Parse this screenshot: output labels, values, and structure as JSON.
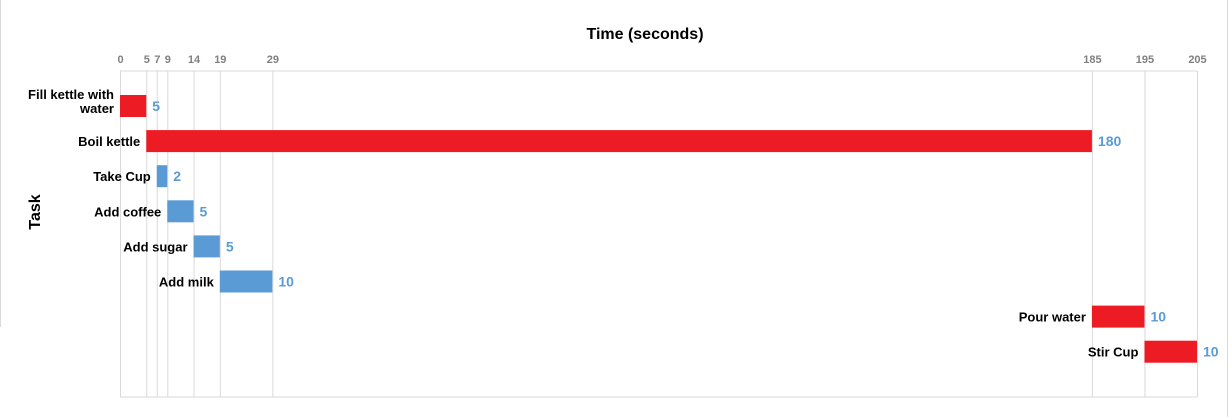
{
  "chart_data": {
    "type": "bar",
    "title": "Time (seconds)",
    "xlabel": "Time (seconds)",
    "ylabel": "Task",
    "xlim": [
      0,
      205
    ],
    "x_ticks": [
      "0",
      "5",
      "7",
      "9",
      "14",
      "19",
      "29",
      "185",
      "195",
      "205"
    ],
    "tasks": [
      {
        "label": [
          "Fill kettle with",
          "water"
        ],
        "start": 0,
        "duration": 5,
        "value_label": "5",
        "color": "#ed1c24"
      },
      {
        "label": [
          "Boil kettle"
        ],
        "start": 5,
        "duration": 180,
        "value_label": "180",
        "color": "#ed1c24"
      },
      {
        "label": [
          "Take Cup"
        ],
        "start": 7,
        "duration": 2,
        "value_label": "2",
        "color": "#5b9bd5"
      },
      {
        "label": [
          "Add coffee"
        ],
        "start": 9,
        "duration": 5,
        "value_label": "5",
        "color": "#5b9bd5"
      },
      {
        "label": [
          "Add sugar"
        ],
        "start": 14,
        "duration": 5,
        "value_label": "5",
        "color": "#5b9bd5"
      },
      {
        "label": [
          "Add milk"
        ],
        "start": 19,
        "duration": 10,
        "value_label": "10",
        "color": "#5b9bd5"
      },
      {
        "label": [
          "Pour water"
        ],
        "start": 185,
        "duration": 10,
        "value_label": "10",
        "color": "#ed1c24"
      },
      {
        "label": [
          "Stir Cup"
        ],
        "start": 195,
        "duration": 10,
        "value_label": "10",
        "color": "#ed1c24"
      }
    ],
    "colors": {
      "critical": "#ed1c24",
      "parallel": "#5b9bd5",
      "value_label": "#5b9bd5",
      "grid": "#d9d9d9",
      "tick": "#808080"
    },
    "grid": true
  }
}
